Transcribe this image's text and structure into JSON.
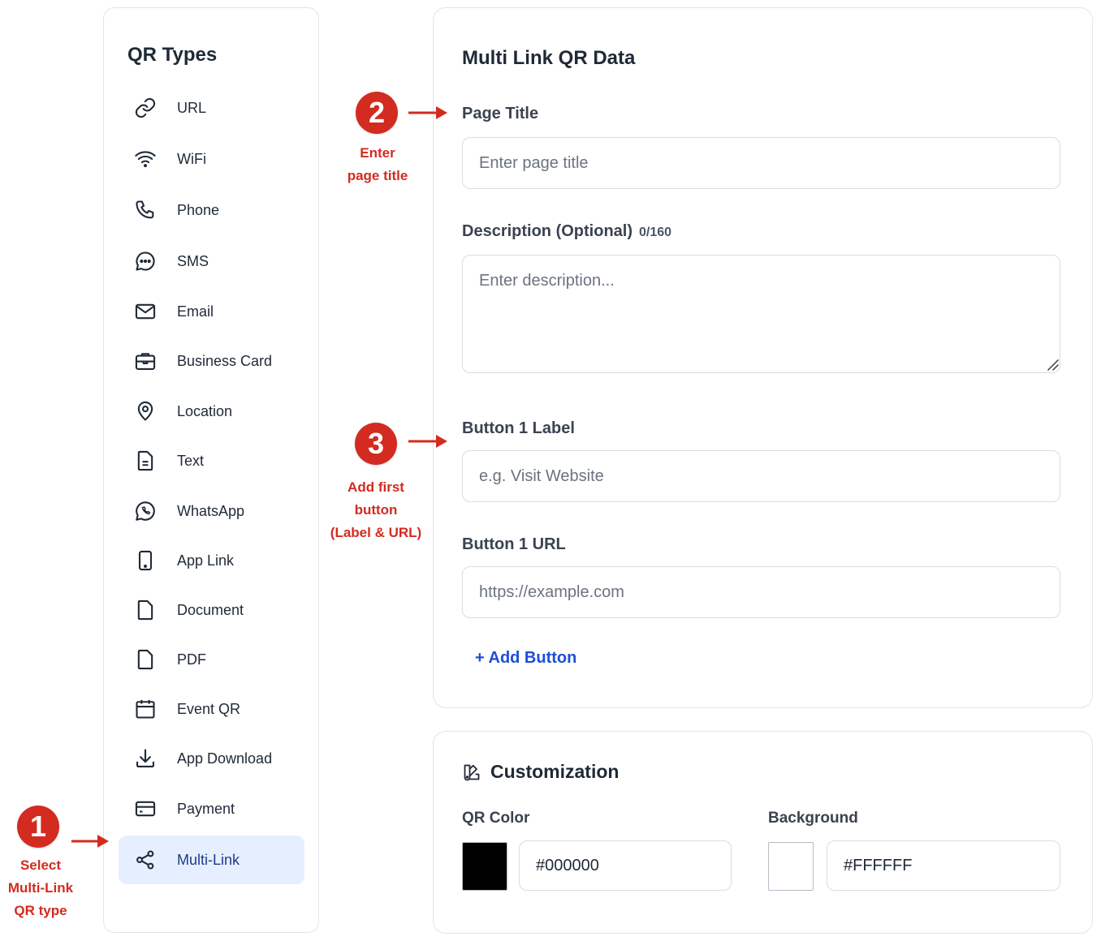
{
  "sidebar": {
    "title": "QR Types",
    "items": [
      {
        "label": "URL",
        "icon": "link-icon"
      },
      {
        "label": "WiFi",
        "icon": "wifi-icon"
      },
      {
        "label": "Phone",
        "icon": "phone-icon"
      },
      {
        "label": "SMS",
        "icon": "message-icon"
      },
      {
        "label": "Email",
        "icon": "mail-icon"
      },
      {
        "label": "Business Card",
        "icon": "briefcase-icon"
      },
      {
        "label": "Location",
        "icon": "map-pin-icon"
      },
      {
        "label": "Text",
        "icon": "text-file-icon"
      },
      {
        "label": "WhatsApp",
        "icon": "whatsapp-icon"
      },
      {
        "label": "App Link",
        "icon": "smartphone-icon"
      },
      {
        "label": "Document",
        "icon": "file-icon"
      },
      {
        "label": "PDF",
        "icon": "file-icon"
      },
      {
        "label": "Event QR",
        "icon": "calendar-icon"
      },
      {
        "label": "App Download",
        "icon": "download-icon"
      },
      {
        "label": "Payment",
        "icon": "credit-card-icon"
      },
      {
        "label": "Multi-Link",
        "icon": "share-icon",
        "active": true
      }
    ]
  },
  "main": {
    "title": "Multi Link QR Data",
    "page_title_label": "Page Title",
    "page_title_placeholder": "Enter page title",
    "description_label": "Description (Optional)",
    "description_counter": "0/160",
    "description_placeholder": "Enter description...",
    "button1_label_label": "Button 1 Label",
    "button1_label_placeholder": "e.g. Visit Website",
    "button1_url_label": "Button 1 URL",
    "button1_url_placeholder": "https://example.com",
    "add_button_label": "+ Add Button"
  },
  "customization": {
    "title": "Customization",
    "qr_color_label": "QR Color",
    "qr_color_value": "#000000",
    "background_label": "Background",
    "background_value": "#FFFFFF"
  },
  "annotations": [
    {
      "number": "1",
      "lines": [
        "Select",
        "Multi-Link",
        "QR type"
      ]
    },
    {
      "number": "2",
      "lines": [
        "Enter",
        "page title"
      ]
    },
    {
      "number": "3",
      "lines": [
        "Add first",
        "button",
        "(Label & URL)"
      ]
    }
  ],
  "colors": {
    "accent": "#1d4ed8",
    "active_bg": "#e6efff",
    "annotation_red": "#d32b1f"
  }
}
